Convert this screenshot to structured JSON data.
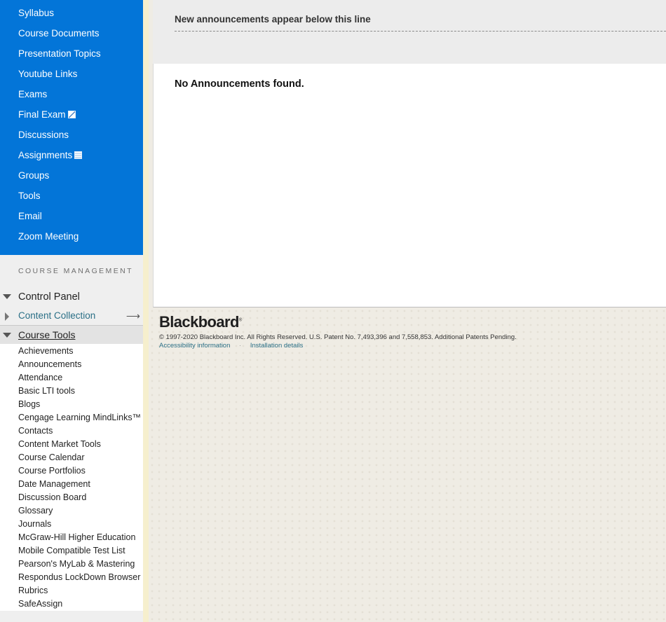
{
  "course_menu": [
    {
      "label": "Syllabus"
    },
    {
      "label": "Course Documents"
    },
    {
      "label": "Presentation Topics"
    },
    {
      "label": "Youtube Links"
    },
    {
      "label": "Exams"
    },
    {
      "label": "Final Exam",
      "icon": "pencil-icon"
    },
    {
      "label": "Discussions"
    },
    {
      "label": "Assignments",
      "icon": "grid-icon"
    },
    {
      "label": "Groups"
    },
    {
      "label": "Tools"
    },
    {
      "label": "Email"
    },
    {
      "label": "Zoom Meeting"
    }
  ],
  "management": {
    "header": "COURSE MANAGEMENT",
    "control_panel": "Control Panel",
    "content_collection": "Content Collection",
    "course_tools": "Course Tools",
    "tools": [
      "Achievements",
      "Announcements",
      "Attendance",
      "Basic LTI tools",
      "Blogs",
      "Cengage Learning MindLinks™",
      "Contacts",
      "Content Market Tools",
      "Course Calendar",
      "Course Portfolios",
      "Date Management",
      "Discussion Board",
      "Glossary",
      "Journals",
      "McGraw-Hill Higher Education",
      "Mobile Compatible Test List",
      "Pearson's MyLab & Mastering",
      "Respondus LockDown Browser",
      "Rubrics",
      "SafeAssign"
    ]
  },
  "main": {
    "announce_line": "New announcements appear below this line",
    "empty_message": "No Announcements found."
  },
  "footer": {
    "logo": "Blackboard",
    "copyright": "© 1997-2020 Blackboard Inc. All Rights Reserved. U.S. Patent No. 7,493,396 and 7,558,853. Additional Patents Pending.",
    "accessibility_link": "Accessibility information",
    "separator": "·",
    "installation_link": "Installation details"
  },
  "colors": {
    "course_menu_bg": "#0375d8",
    "link_teal": "#2a6f86"
  }
}
